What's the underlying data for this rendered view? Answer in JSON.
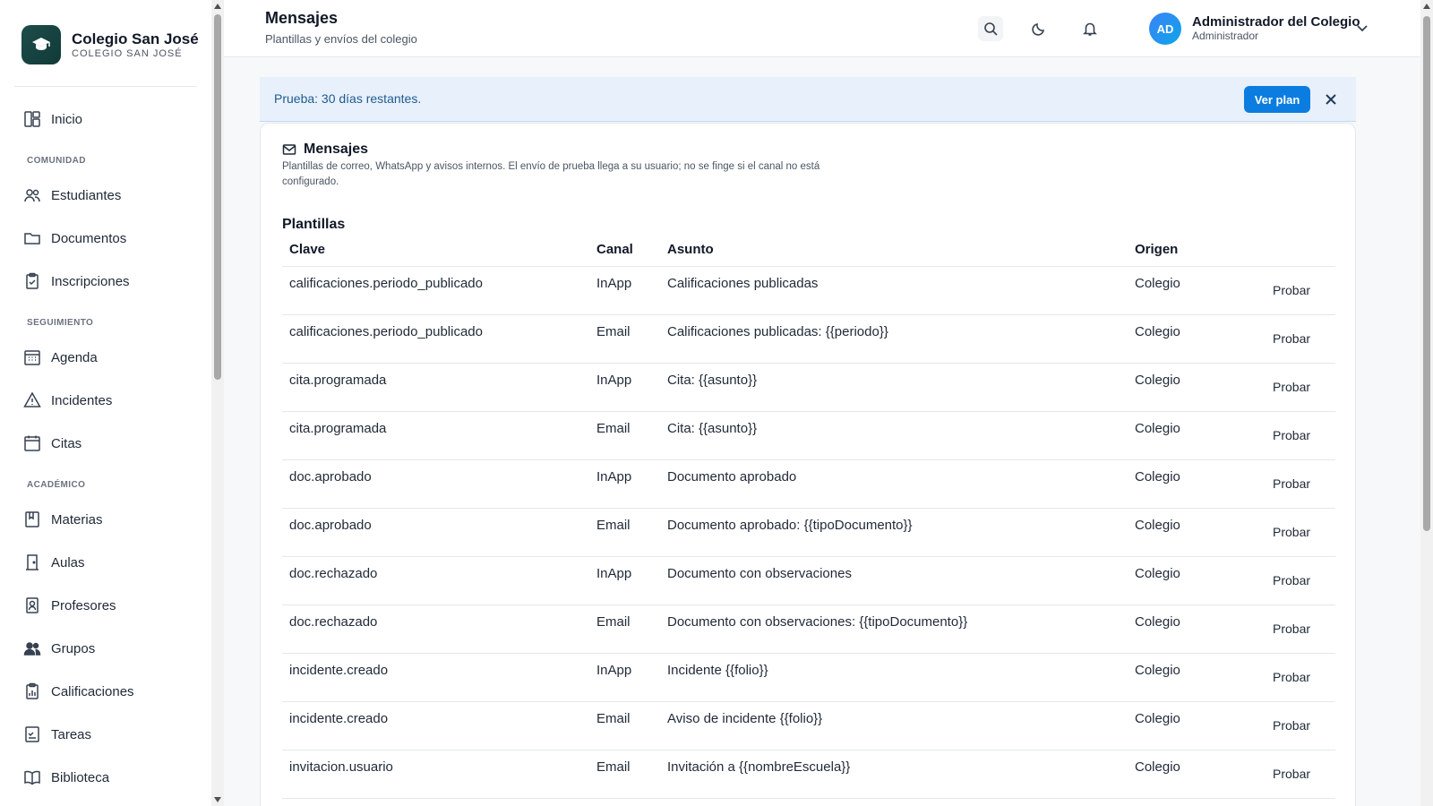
{
  "brand": {
    "name": "Colegio San José",
    "subtitle": "COLEGIO SAN JOSÉ"
  },
  "sidebar": {
    "home": "Inicio",
    "sections": [
      {
        "title": "COMUNIDAD",
        "items": [
          "Estudiantes",
          "Documentos",
          "Inscripciones"
        ]
      },
      {
        "title": "SEGUIMIENTO",
        "items": [
          "Agenda",
          "Incidentes",
          "Citas"
        ]
      },
      {
        "title": "ACADÉMICO",
        "items": [
          "Materias",
          "Aulas",
          "Profesores",
          "Grupos",
          "Calificaciones",
          "Tareas",
          "Biblioteca"
        ]
      }
    ]
  },
  "header": {
    "title": "Mensajes",
    "subtitle": "Plantillas y envíos del colegio",
    "user": {
      "initials": "AD",
      "name": "Administrador del Colegio",
      "role": "Administrador"
    }
  },
  "banner": {
    "text": "Prueba: 30 días restantes.",
    "button": "Ver plan"
  },
  "card": {
    "title": "Mensajes",
    "description": "Plantillas de correo, WhatsApp y avisos internos. El envío de prueba llega a su usuario; no se finge si el canal no está configurado.",
    "section": "Plantillas",
    "columns": {
      "clave": "Clave",
      "canal": "Canal",
      "asunto": "Asunto",
      "origen": "Origen"
    },
    "action_label": "Probar",
    "rows": [
      {
        "clave": "calificaciones.periodo_publicado",
        "canal": "InApp",
        "asunto": "Calificaciones publicadas",
        "origen": "Colegio"
      },
      {
        "clave": "calificaciones.periodo_publicado",
        "canal": "Email",
        "asunto": "Calificaciones publicadas: {{periodo}}",
        "origen": "Colegio"
      },
      {
        "clave": "cita.programada",
        "canal": "InApp",
        "asunto": "Cita: {{asunto}}",
        "origen": "Colegio"
      },
      {
        "clave": "cita.programada",
        "canal": "Email",
        "asunto": "Cita: {{asunto}}",
        "origen": "Colegio"
      },
      {
        "clave": "doc.aprobado",
        "canal": "InApp",
        "asunto": "Documento aprobado",
        "origen": "Colegio"
      },
      {
        "clave": "doc.aprobado",
        "canal": "Email",
        "asunto": "Documento aprobado: {{tipoDocumento}}",
        "origen": "Colegio"
      },
      {
        "clave": "doc.rechazado",
        "canal": "InApp",
        "asunto": "Documento con observaciones",
        "origen": "Colegio"
      },
      {
        "clave": "doc.rechazado",
        "canal": "Email",
        "asunto": "Documento con observaciones: {{tipoDocumento}}",
        "origen": "Colegio"
      },
      {
        "clave": "incidente.creado",
        "canal": "InApp",
        "asunto": "Incidente {{folio}}",
        "origen": "Colegio"
      },
      {
        "clave": "incidente.creado",
        "canal": "Email",
        "asunto": "Aviso de incidente {{folio}}",
        "origen": "Colegio"
      },
      {
        "clave": "invitacion.usuario",
        "canal": "Email",
        "asunto": "Invitación a {{nombreEscuela}}",
        "origen": "Colegio"
      }
    ]
  },
  "icons": {
    "brand": "graduation-cap-icon",
    "home": "layout-icon",
    "students": "users-icon",
    "documents": "folder-icon",
    "enrollments": "clipboard-check-icon",
    "agenda": "calendar-grid-icon",
    "incidents": "warning-triangle-icon",
    "appointments": "calendar-icon",
    "subjects": "book-flag-icon",
    "classrooms": "door-icon",
    "teachers": "id-badge-icon",
    "groups": "group-icon",
    "grades": "chart-clipboard-icon",
    "tasks": "checklist-icon",
    "library": "open-book-icon",
    "search": "search-icon",
    "theme": "moon-icon",
    "notifications": "bell-icon",
    "chevron": "chevron-down-icon",
    "close": "close-icon",
    "mail": "mail-icon"
  },
  "colors": {
    "brand": "#1e4d4a",
    "accent": "#0b7de0",
    "banner_bg": "#e8f1fb",
    "banner_text": "#1f5a8f"
  }
}
